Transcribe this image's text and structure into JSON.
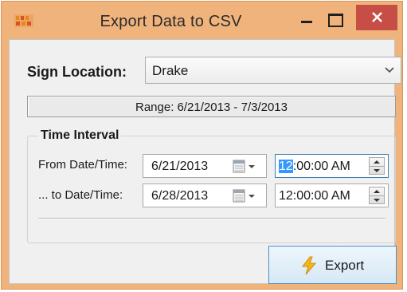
{
  "window": {
    "title": "Export Data to CSV",
    "accent_color": "#f1b37c",
    "close_color": "#c74e47",
    "app_icon": "app-logo-icon"
  },
  "sign_location": {
    "label": "Sign Location:",
    "selected": "Drake"
  },
  "range": {
    "text": "Range: 6/21/2013 - 7/3/2013"
  },
  "time_interval": {
    "title": "Time Interval",
    "from": {
      "label": "From Date/Time:",
      "date": "6/21/2013",
      "time_selected": "12",
      "time_rest": ":00:00 AM"
    },
    "to": {
      "label": "... to Date/Time:",
      "date": "6/28/2013",
      "time": "12:00:00 AM"
    }
  },
  "actions": {
    "export_label": "Export",
    "export_icon": "lightning-bolt-icon"
  }
}
